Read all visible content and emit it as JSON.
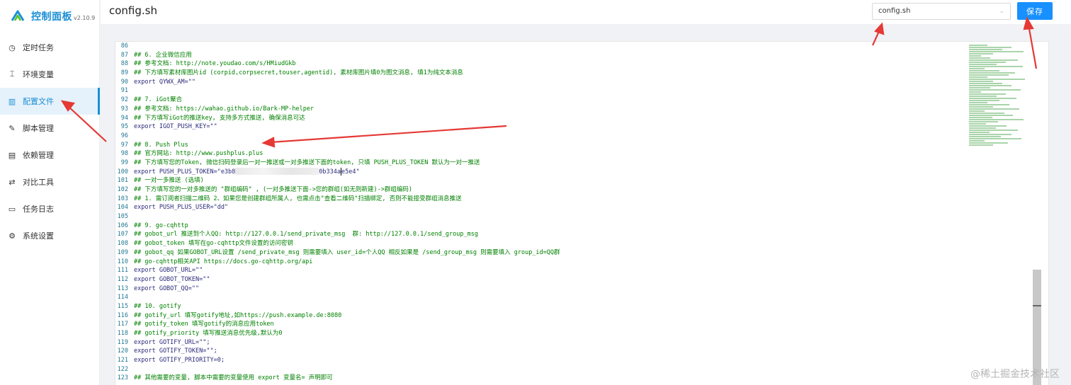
{
  "app": {
    "name": "控制面板",
    "version": "v2.10.9",
    "brand_color": "#1a8fd6"
  },
  "sidebar": {
    "items": [
      {
        "label": "定时任务",
        "icon": "clock-icon",
        "active": false
      },
      {
        "label": "环境变量",
        "icon": "env-icon",
        "active": false
      },
      {
        "label": "配置文件",
        "icon": "config-icon",
        "active": true
      },
      {
        "label": "脚本管理",
        "icon": "edit-icon",
        "active": false
      },
      {
        "label": "依赖管理",
        "icon": "dependency-icon",
        "active": false
      },
      {
        "label": "对比工具",
        "icon": "diff-icon",
        "active": false
      },
      {
        "label": "任务日志",
        "icon": "folder-icon",
        "active": false
      },
      {
        "label": "系统设置",
        "icon": "gear-icon",
        "active": false
      }
    ]
  },
  "header": {
    "title": "config.sh",
    "file_select_value": "config.sh",
    "save_label": "保存",
    "save_color": "#1890ff"
  },
  "editor": {
    "lines": [
      {
        "n": "86",
        "t": ""
      },
      {
        "n": "87",
        "t": "## 6. 企业微信应用"
      },
      {
        "n": "88",
        "t": "## 参考文档: http://note.youdao.com/s/HMiudGkb"
      },
      {
        "n": "89",
        "t": "## 下方填写素材库图片id (corpid,corpsecret,touser,agentid), 素材库图片填0为图文消息, 填1为纯文本消息"
      },
      {
        "n": "90",
        "t": "export QYWX_AM=\"\"",
        "export": true
      },
      {
        "n": "91",
        "t": ""
      },
      {
        "n": "92",
        "t": "## 7. iGot聚合"
      },
      {
        "n": "93",
        "t": "## 参考文档: https://wahao.github.io/Bark-MP-helper"
      },
      {
        "n": "94",
        "t": "## 下方填写iGot的推送key, 支持多方式推送, 确保消息可达"
      },
      {
        "n": "95",
        "t": "export IGOT_PUSH_KEY=\"\"",
        "export": true
      },
      {
        "n": "96",
        "t": ""
      },
      {
        "n": "97",
        "t": "## 8. Push Plus"
      },
      {
        "n": "98",
        "t": "## 官方网站: http://www.pushplus.plus"
      },
      {
        "n": "99",
        "t": "## 下方填写您的Token, 微信扫码登录后一对一推送或一对多推送下面的token, 只填 PUSH_PLUS_TOKEN 默认为一对一推送"
      },
      {
        "n": "100",
        "t": "export PUSH_PLUS_TOKEN=\"e3b8",
        "t2": "0b334a",
        "t3": "e5e4\"",
        "export": true,
        "masked": true
      },
      {
        "n": "101",
        "t": "## 一对一多推送 (选填)"
      },
      {
        "n": "102",
        "t": "## 下方填写您的一对多推送的 \"群组编码\" , (一对多推送下面->您的群组(如无则新建)->群组编码)"
      },
      {
        "n": "103",
        "t": "## 1. 需订阅者扫描二维码 2、如果您是创建群组所属人, 也需点击\"查看二维码\"扫描绑定, 否则不能接受群组消息推送"
      },
      {
        "n": "104",
        "t": "export PUSH_PLUS_USER=\"dd\"",
        "export": true
      },
      {
        "n": "105",
        "t": ""
      },
      {
        "n": "106",
        "t": "## 9. go-cqhttp"
      },
      {
        "n": "107",
        "t": "## gobot_url 推送到个人QQ: http://127.0.0.1/send_private_msg  群: http://127.0.0.1/send_group_msg"
      },
      {
        "n": "108",
        "t": "## gobot_token 填写在go-cqhttp文件设置的访问密钥"
      },
      {
        "n": "109",
        "t": "## gobot_qq 如果GOBOT_URL设置 /send_private_msg 则需要填入 user_id=个人QQ 相反如果是 /send_group_msg 则需要填入 group_id=QQ群"
      },
      {
        "n": "110",
        "t": "## go-cqhttp相关API https://docs.go-cqhttp.org/api"
      },
      {
        "n": "111",
        "t": "export GOBOT_URL=\"\"",
        "export": true
      },
      {
        "n": "112",
        "t": "export GOBOT_TOKEN=\"\"",
        "export": true
      },
      {
        "n": "113",
        "t": "export GOBOT_QQ=\"\"",
        "export": true
      },
      {
        "n": "114",
        "t": ""
      },
      {
        "n": "115",
        "t": "## 10. gotify"
      },
      {
        "n": "116",
        "t": "## gotify_url 填写gotify地址,如https://push.example.de:8080"
      },
      {
        "n": "117",
        "t": "## gotify_token 填写gotify的消息应用token"
      },
      {
        "n": "118",
        "t": "## gotify_priority 填写推送消息优先级,默认为0"
      },
      {
        "n": "119",
        "t": "export GOTIFY_URL=\"\";",
        "export": true
      },
      {
        "n": "120",
        "t": "export GOTIFY_TOKEN=\"\";",
        "export": true
      },
      {
        "n": "121",
        "t": "export GOTIFY_PRIORITY=0;",
        "export": true
      },
      {
        "n": "122",
        "t": ""
      },
      {
        "n": "123",
        "t": "## 其他需要的变量, 脚本中需要的变量使用 export 变量名= 声明即可"
      }
    ]
  },
  "watermark": "@稀土掘金技术社区"
}
